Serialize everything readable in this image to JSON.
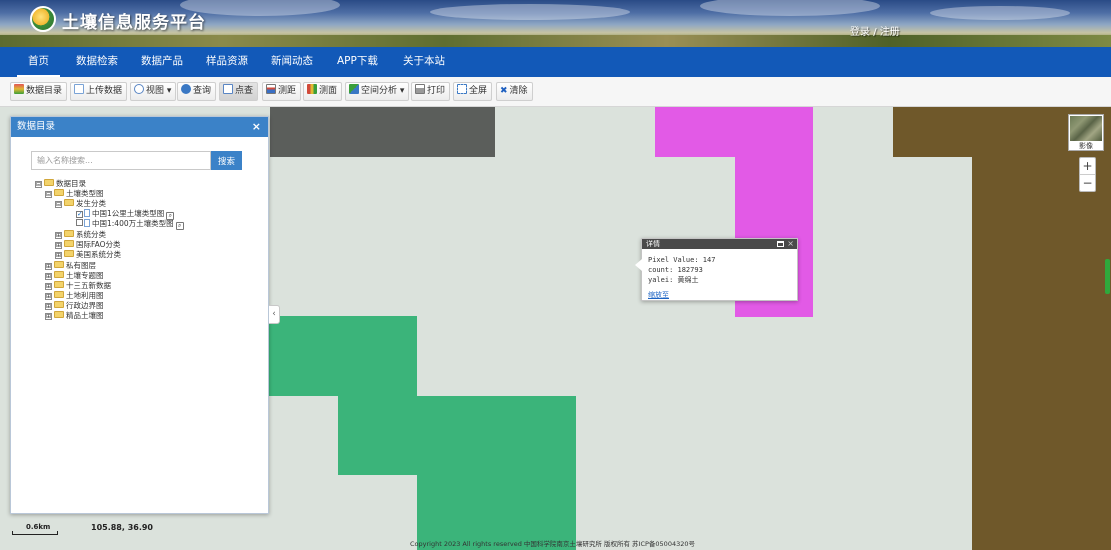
{
  "header": {
    "site_title": "土壤信息服务平台",
    "login_label": "登录",
    "separator": "/",
    "register_label": "注册"
  },
  "nav": {
    "items": [
      "首页",
      "数据检索",
      "数据产品",
      "样品资源",
      "新闻动态",
      "APP下载",
      "关于本站"
    ],
    "active_index": 0
  },
  "toolbar": {
    "buttons": [
      {
        "label": "数据目录",
        "icon": "catalog-icon"
      },
      {
        "label": "上传数据",
        "icon": "upload-icon"
      },
      {
        "label": "视图",
        "icon": "view-icon",
        "dropdown": "▾"
      },
      {
        "label": "查询",
        "icon": "query-icon"
      },
      {
        "label": "点查",
        "icon": "point-query-icon"
      },
      {
        "label": "测距",
        "icon": "ruler-icon"
      },
      {
        "label": "测面",
        "icon": "area-measure-icon"
      },
      {
        "label": "空间分析",
        "icon": "spatial-analysis-icon",
        "dropdown": "▾"
      },
      {
        "label": "打印",
        "icon": "print-icon"
      },
      {
        "label": "全屏",
        "icon": "fullscreen-icon"
      },
      {
        "label": "清除",
        "icon": "clear-icon",
        "glyph": "✖"
      }
    ],
    "pressed_index": 4
  },
  "panel": {
    "title": "数据目录",
    "close_glyph": "×",
    "search_placeholder": "输入名称搜索...",
    "search_button": "搜索",
    "tree": [
      {
        "label": "数据目录",
        "level": 0,
        "exp": "⊟"
      },
      {
        "label": "土壤类型图",
        "level": 1,
        "exp": "⊟"
      },
      {
        "label": "发生分类",
        "level": 2,
        "exp": "⊟"
      },
      {
        "label": "中国1公里土壤类型图",
        "level": 3,
        "checked": true
      },
      {
        "label": "中国1:400万土壤类型图",
        "level": 3,
        "checked": false
      },
      {
        "label": "系统分类",
        "level": 2,
        "exp": "⊞"
      },
      {
        "label": "国际FAO分类",
        "level": 2,
        "exp": "⊞"
      },
      {
        "label": "美国系统分类",
        "level": 2,
        "exp": "⊞"
      },
      {
        "label": "私有图层",
        "level": 1,
        "exp": "⊞"
      },
      {
        "label": "土壤专题图",
        "level": 1,
        "exp": "⊞"
      },
      {
        "label": "十三五新数据",
        "level": 1,
        "exp": "⊞"
      },
      {
        "label": "土地利用图",
        "level": 1,
        "exp": "⊞"
      },
      {
        "label": "行政边界图",
        "level": 1,
        "exp": "⊞"
      },
      {
        "label": "精品土壤图",
        "level": 1,
        "exp": "⊞"
      }
    ]
  },
  "popup": {
    "title": "详情",
    "close_glyph": "×",
    "lines": [
      "Pixel Value: 147",
      "count: 182793",
      "yalei: 黄绵土"
    ],
    "link": "缩放至"
  },
  "map": {
    "basemap_label": "影像",
    "zoom_in": "+",
    "zoom_out": "−",
    "collapse_glyph": "‹",
    "scale_label": "0.6km",
    "coords": "105.88, 36.90",
    "copyright": "Copyright 2023 All rights reserved 中国科学院南京土壤研究所 版权所有 苏ICP备05004320号",
    "colors": {
      "background": "#dbe2dc",
      "dark_gray": "#5b5e5b",
      "magenta": "#e25ae6",
      "brown": "#6f582a",
      "green": "#3bb47a"
    }
  }
}
